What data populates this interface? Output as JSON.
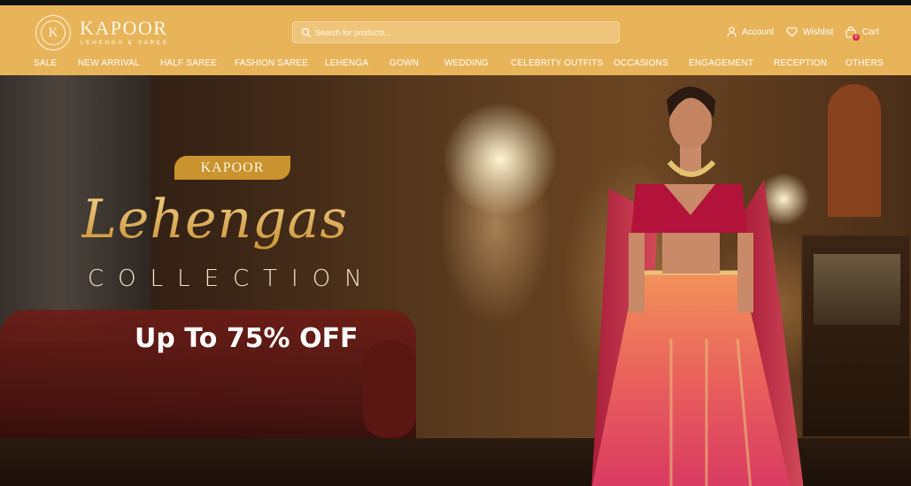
{
  "brand": {
    "name": "KAPOOR",
    "tagline": "LEHENGA & SAREE",
    "monogram": "K"
  },
  "search": {
    "placeholder": "Search for products..."
  },
  "header_actions": {
    "account": "Account",
    "wishlist": "Wishlist",
    "cart": "Cart",
    "cart_count": "0"
  },
  "nav": [
    "SALE",
    "NEW ARRIVAL",
    "HALF SAREE",
    "FASHION SAREE",
    "LEHENGA",
    "GOWN",
    "WEDDING",
    "CELEBRITY OUTFITS",
    "OCCASIONS",
    "ENGAGEMENT",
    "RECEPTION",
    "OTHERS"
  ],
  "hero": {
    "brand_pill": "KAPOOR",
    "title": "Lehengas",
    "subtitle": "COLLECTION",
    "offer": "Up To 75% OFF"
  },
  "colors": {
    "header_bg": "#e8b45a",
    "gold": "#c9932f",
    "cart_badge": "#d9263a"
  },
  "icons": [
    "search-icon",
    "account-icon",
    "heart-icon",
    "shopping-bag-icon"
  ]
}
